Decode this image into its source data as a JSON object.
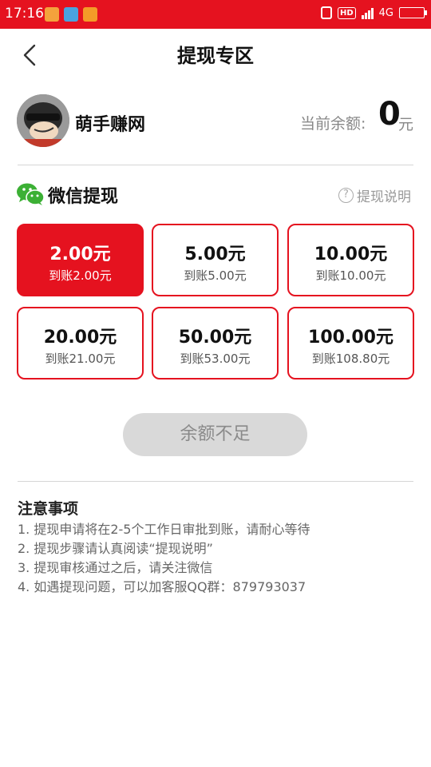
{
  "status_bar": {
    "time": "17:16",
    "network": "4G",
    "hd": "HD",
    "bg_color": "#e5121f",
    "battery_level": 0.9
  },
  "header": {
    "title": "提现专区",
    "back_icon": "chevron-left-icon"
  },
  "profile": {
    "username": "萌手赚网",
    "balance_label": "当前余额:",
    "balance_amount": "0",
    "balance_unit": "元"
  },
  "withdraw": {
    "method_title": "微信提现",
    "method_icon": "wechat-icon",
    "help_label": "提现说明",
    "options": [
      {
        "amount": "2.00元",
        "receive": "到账2.00元",
        "selected": true
      },
      {
        "amount": "5.00元",
        "receive": "到账5.00元",
        "selected": false
      },
      {
        "amount": "10.00元",
        "receive": "到账10.00元",
        "selected": false
      },
      {
        "amount": "20.00元",
        "receive": "到账21.00元",
        "selected": false
      },
      {
        "amount": "50.00元",
        "receive": "到账53.00元",
        "selected": false
      },
      {
        "amount": "100.00元",
        "receive": "到账108.80元",
        "selected": false
      }
    ],
    "submit_label": "余额不足"
  },
  "notes": {
    "title": "注意事项",
    "items": [
      "1. 提现申请将在2-5个工作日审批到账，请耐心等待",
      "2. 提现步骤请认真阅读“提现说明”",
      "3. 提现审核通过之后，请关注微信",
      "4. 如遇提现问题，可以加客服QQ群：879793037"
    ]
  },
  "colors": {
    "accent": "#e5121f",
    "wechat_green": "#3cb035",
    "disabled_bg": "#d9d9d9"
  }
}
